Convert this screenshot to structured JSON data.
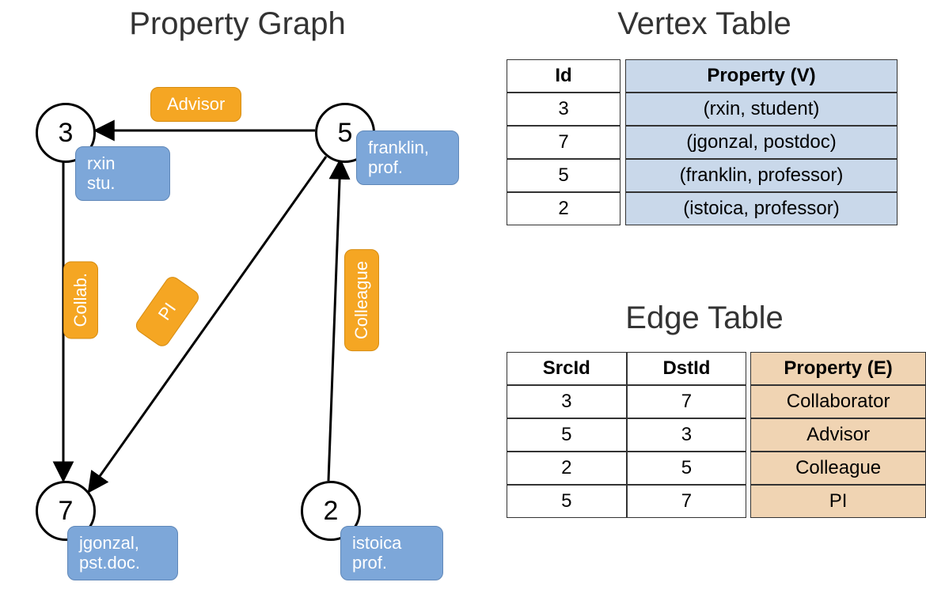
{
  "titles": {
    "graph": "Property Graph",
    "vertex_table": "Vertex Table",
    "edge_table": "Edge Table"
  },
  "nodes": {
    "n3": {
      "id": "3",
      "label1": "rxin",
      "label2": "stu."
    },
    "n5": {
      "id": "5",
      "label1": "franklin,",
      "label2": "prof."
    },
    "n7": {
      "id": "7",
      "label1": "jgonzal,",
      "label2": "pst.doc."
    },
    "n2": {
      "id": "2",
      "label1": "istoica",
      "label2": "prof."
    }
  },
  "edge_labels": {
    "advisor": "Advisor",
    "collab": "Collab.",
    "pi": "PI",
    "colleague": "Colleague"
  },
  "vertex_table": {
    "headers": {
      "id": "Id",
      "prop": "Property (V)"
    },
    "rows": [
      {
        "id": "3",
        "prop": "(rxin, student)"
      },
      {
        "id": "7",
        "prop": "(jgonzal, postdoc)"
      },
      {
        "id": "5",
        "prop": "(franklin, professor)"
      },
      {
        "id": "2",
        "prop": "(istoica, professor)"
      }
    ]
  },
  "edge_table": {
    "headers": {
      "src": "SrcId",
      "dst": "DstId",
      "prop": "Property (E)"
    },
    "rows": [
      {
        "src": "3",
        "dst": "7",
        "prop": "Collaborator"
      },
      {
        "src": "5",
        "dst": "3",
        "prop": "Advisor"
      },
      {
        "src": "2",
        "dst": "5",
        "prop": "Colleague"
      },
      {
        "src": "5",
        "dst": "7",
        "prop": "PI"
      }
    ]
  }
}
